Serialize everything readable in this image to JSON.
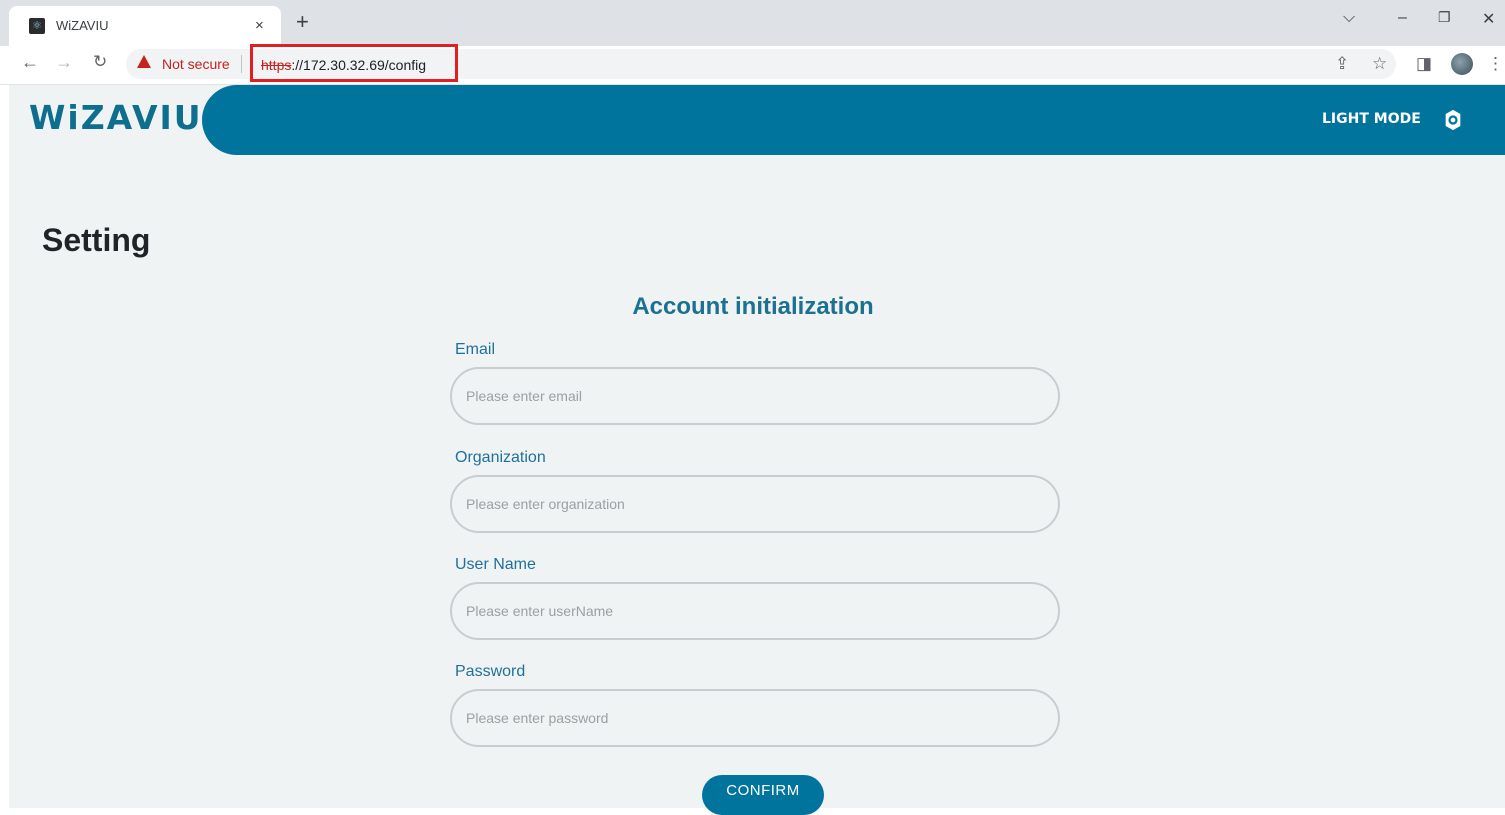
{
  "browser": {
    "tab_title": "WiZAVIU",
    "tab_close": "×",
    "new_tab": "+",
    "security_label": "Not secure",
    "url_scheme": "https",
    "url_rest": "://172.30.32.69/config"
  },
  "app": {
    "logo": "WiZAVIU",
    "theme_toggle_label": "LIGHT MODE",
    "page_title": "Setting",
    "form": {
      "title": "Account initialization",
      "fields": [
        {
          "label": "Email",
          "placeholder": "Please enter email"
        },
        {
          "label": "Organization",
          "placeholder": "Please enter organization"
        },
        {
          "label": "User Name",
          "placeholder": "Please enter userName"
        },
        {
          "label": "Password",
          "placeholder": "Please enter password"
        }
      ],
      "submit_label": "CONFIRM"
    }
  },
  "colors": {
    "brand": "#00749c",
    "page_background": "#eff3f4",
    "heading_text": "#1c7190",
    "warning": "#c5221f"
  }
}
